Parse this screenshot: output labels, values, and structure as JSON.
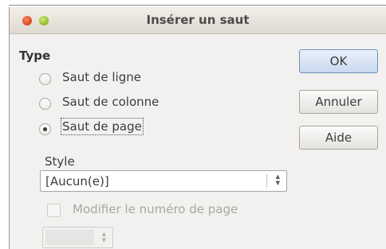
{
  "window": {
    "title": "Insérer un saut"
  },
  "type_section": {
    "heading": "Type",
    "options": [
      {
        "label": "Saut de ligne",
        "checked": false
      },
      {
        "label": "Saut de colonne",
        "checked": false
      },
      {
        "label": "Saut de page",
        "checked": true
      }
    ]
  },
  "style_section": {
    "label": "Style",
    "selected": "[Aucun(e)]"
  },
  "page_number": {
    "checkbox_label": "Modifier le numéro de page",
    "checked": false,
    "enabled": false,
    "value": ""
  },
  "buttons": {
    "ok": "OK",
    "cancel": "Annuler",
    "help": "Aide"
  },
  "colors": {
    "primary_button": "#c9d9ef",
    "dialog_bg": "#f2f1f0",
    "close_button": "#e0471c",
    "minimize_button": "#8fbf2a"
  }
}
